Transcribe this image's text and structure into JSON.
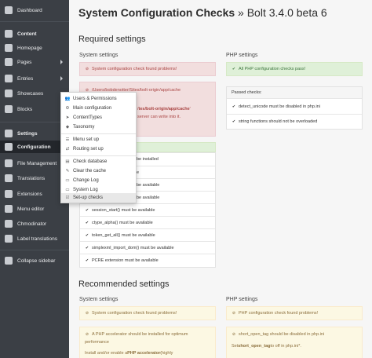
{
  "sidebar": {
    "items": [
      {
        "label": "Dashboard",
        "icon": "dashboard-icon"
      },
      {
        "label": "Content",
        "icon": "content-icon"
      },
      {
        "label": "Homepage",
        "icon": "homepage-icon"
      },
      {
        "label": "Pages",
        "icon": "pages-icon"
      },
      {
        "label": "Entries",
        "icon": "entries-icon"
      },
      {
        "label": "Showcases",
        "icon": "showcases-icon"
      },
      {
        "label": "Blocks",
        "icon": "blocks-icon"
      },
      {
        "label": "Settings",
        "icon": "settings-icon"
      },
      {
        "label": "Configuration",
        "icon": "configuration-icon"
      },
      {
        "label": "File Management",
        "icon": "file-management-icon"
      },
      {
        "label": "Translations",
        "icon": "translations-icon"
      },
      {
        "label": "Extensions",
        "icon": "extensions-icon"
      },
      {
        "label": "Menu editor",
        "icon": "menu-editor-icon"
      },
      {
        "label": "Chmodinator",
        "icon": "chmodinator-icon"
      },
      {
        "label": "Label translations",
        "icon": "label-translations-icon"
      },
      {
        "label": "Collapse sidebar",
        "icon": "collapse-icon"
      }
    ]
  },
  "flyout": {
    "items": [
      "Users & Permissions",
      "Main configuration",
      "ContentTypes",
      "Taxonomy",
      "Menu set up",
      "Routing set up",
      "Check database",
      "Clear the cache",
      "Change Log",
      "System Log",
      "Set-up checks"
    ]
  },
  "page": {
    "title_bold": "System Configuration Checks",
    "title_rest": " » Bolt 3.4.0 beta 6"
  },
  "required": {
    "heading": "Required settings",
    "system": {
      "heading": "System settings",
      "problem": "System configuration check found problems!",
      "detail1": "/Users/bobdenotter/Sites/bolt-origin/app/cache",
      "detail2_prefix": "/",
      "detail2_bold": "tes/bolt-origin/app/cache",
      "detail2_suffix": "'",
      "detail3": "server can write into it.",
      "checks": [
        "be installed",
        "e",
        "be available",
        "be available",
        "session_start() must be available",
        "ctype_alpha() must be available",
        "token_get_all() must be available",
        "simplexml_import_dom() must be available",
        "PCRE extension must be available"
      ]
    },
    "php": {
      "heading": "PHP settings",
      "ok": "All PHP configuration checks pass!",
      "passed_heading": "Passed checks:",
      "checks": [
        "detect_unicode must be disabled in php.ini",
        "string functions should not be overloaded"
      ]
    }
  },
  "recommended": {
    "heading": "Recommended settings",
    "system": {
      "heading": "System settings",
      "problem": "System configuration check found problems!",
      "detail1": "A PHP accelerator should be installed for optimum",
      "detail2": "performance",
      "detail3_prefix": "Install and/or enable a ",
      "detail3_bold": "PHP accelerator",
      "detail3_suffix": " (highly"
    },
    "php": {
      "heading": "PHP settings",
      "problem": "PHP configuration check found problems!",
      "detail1": "short_open_tag should be disabled in php.ini",
      "detail2_prefix": "Set ",
      "detail2_bold": "short_open_tag",
      "detail2_suffix": " to off in php.ini*."
    }
  },
  "colors": {
    "sidebar_bg": "#3b3f45",
    "danger_bg": "#f2dede",
    "success_bg": "#dff0d8",
    "warning_bg": "#fcf8e3"
  }
}
